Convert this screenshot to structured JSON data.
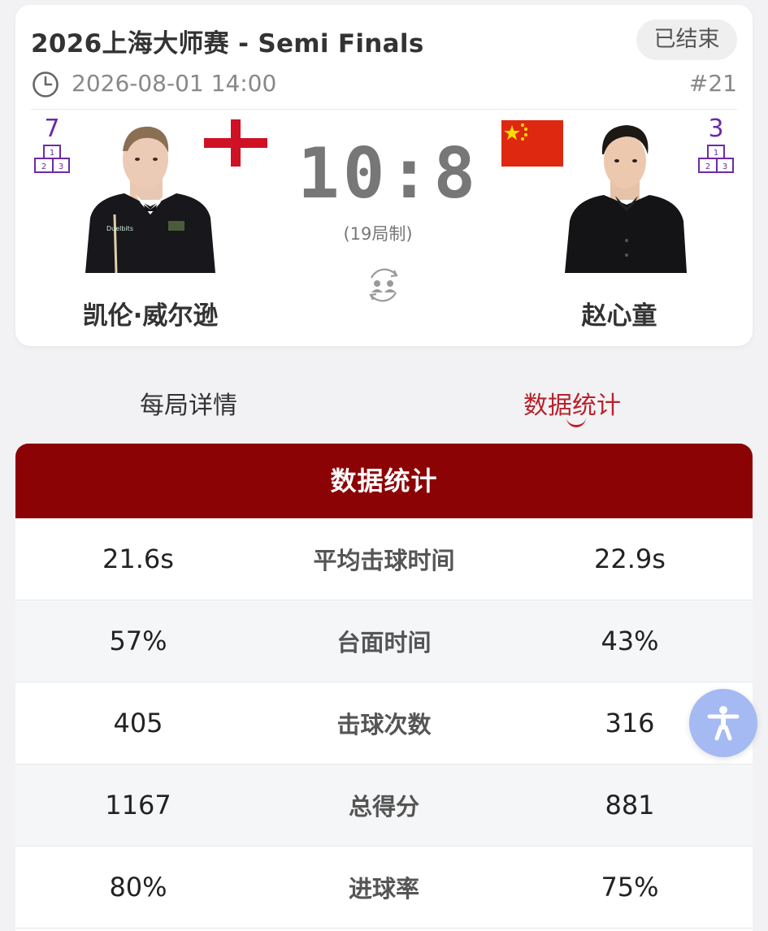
{
  "match": {
    "title": "2026上海大师赛 - Semi Finals",
    "status": "已结束",
    "datetime": "2026-08-01 14:00",
    "number": "#21",
    "score": "10:8",
    "format": "(19局制)"
  },
  "player_left": {
    "rank": "7",
    "name": "凯伦·威尔逊",
    "flag": "england-flag"
  },
  "player_right": {
    "rank": "3",
    "name": "赵心童",
    "flag": "china-flag"
  },
  "podium": {
    "first": "1",
    "second": "2",
    "third": "3"
  },
  "tabs": [
    {
      "label": "每局详情"
    },
    {
      "label": "数据统计",
      "active": true
    }
  ],
  "stats": {
    "header": "数据统计",
    "rows": [
      {
        "label": "平均击球时间",
        "left": "21.6s",
        "right": "22.9s"
      },
      {
        "label": "台面时间",
        "left": "57%",
        "right": "43%"
      },
      {
        "label": "击球次数",
        "left": "405",
        "right": "316"
      },
      {
        "label": "总得分",
        "left": "1167",
        "right": "881"
      },
      {
        "label": "进球率",
        "left": "80%",
        "right": "75%"
      }
    ]
  },
  "colors": {
    "accent": "#b8222b",
    "header_bg": "#8c0306",
    "rank": "#6b2ba8",
    "a11y": "#a5b9f3"
  },
  "icons": [
    "clock-icon",
    "podium-icon",
    "swap-players-icon",
    "accessibility-icon"
  ]
}
